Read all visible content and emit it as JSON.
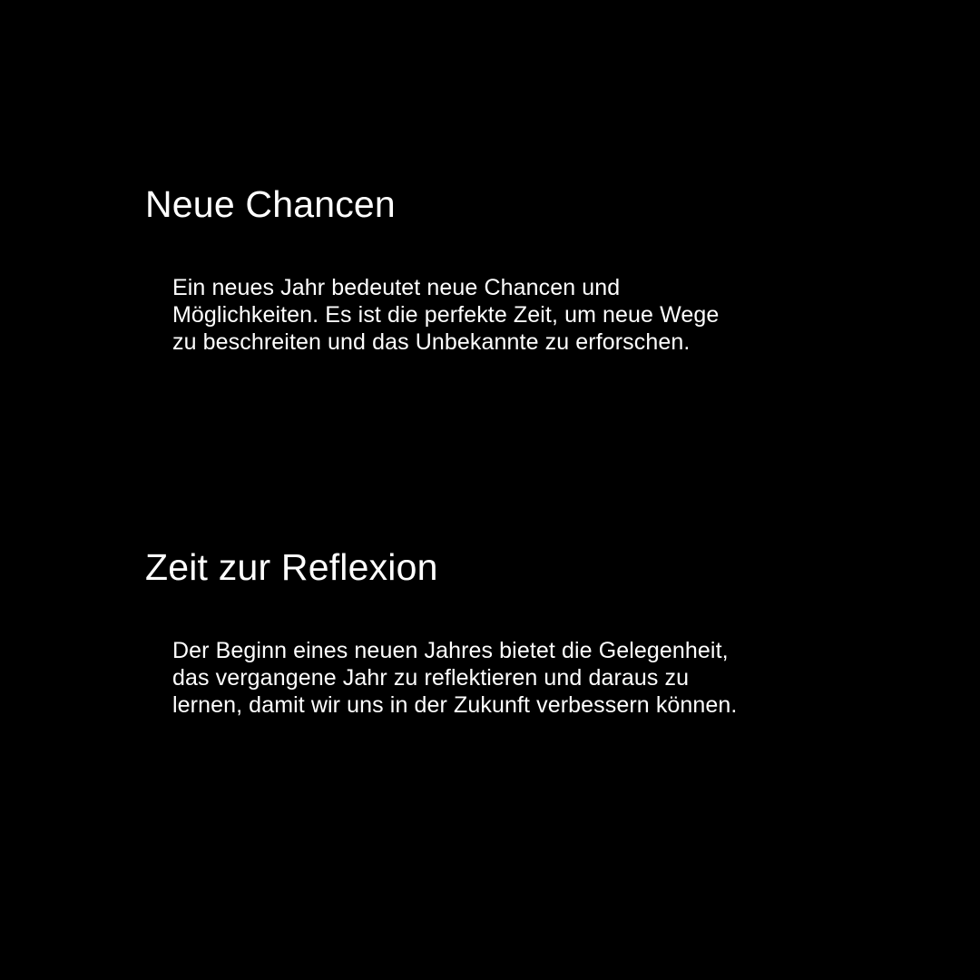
{
  "colors": {
    "background": "#000000",
    "text": "#ffffff"
  },
  "sections": [
    {
      "heading": "Neue Chancen",
      "body": "Ein neues Jahr bedeutet neue Chancen und Möglichkeiten. Es ist die perfekte Zeit, um neue Wege zu beschreiten und das Unbekannte zu erforschen."
    },
    {
      "heading": "Zeit zur Reflexion",
      "body": "Der Beginn eines neuen Jahres bietet die Gelegenheit, das vergangene Jahr zu reflektieren und daraus zu lernen, damit wir uns in der Zukunft verbessern können."
    }
  ]
}
